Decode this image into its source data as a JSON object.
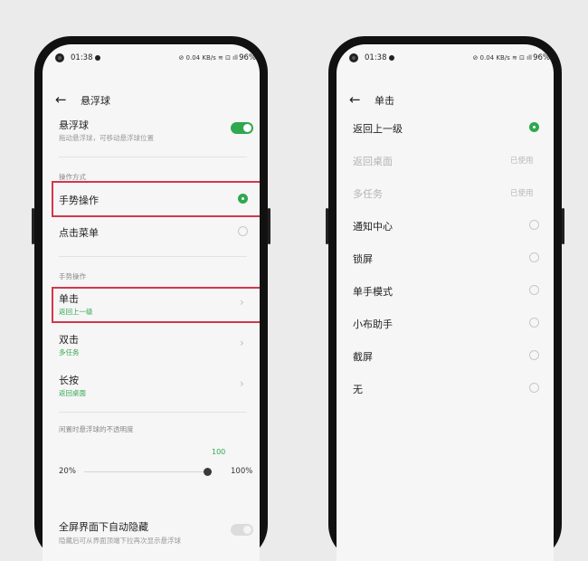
{
  "status": {
    "time": "01:38",
    "icons": "⊘ 0.04 KB/s ≋ ⊡ ıll",
    "battery": "96%"
  },
  "floating_ball": {
    "title": "悬浮球",
    "toggle_label": "悬浮球",
    "toggle_desc": "拖动悬浮球，可移动悬浮球位置",
    "toggle_on": true,
    "section_op_mode": "操作方式",
    "gesture_label": "手势操作",
    "menu_label": "点击菜单",
    "section_gestures": "手势操作",
    "gestures": [
      {
        "label": "单击",
        "value": "返回上一级"
      },
      {
        "label": "双击",
        "value": "多任务"
      },
      {
        "label": "长按",
        "value": "返回桌面"
      }
    ],
    "opacity_label": "闲置时悬浮球的不透明度",
    "opacity_value": "100",
    "opacity_min": "20%",
    "opacity_max": "100%",
    "opacity_level": 1.0,
    "fullscreen_label": "全屏界面下自动隐藏",
    "fullscreen_desc": "隐藏后可从界面顶端下拉再次显示悬浮球",
    "fullscreen_on": false
  },
  "single_tap": {
    "title": "单击",
    "used_label": "已使用",
    "options": [
      {
        "label": "返回上一级",
        "selected": true
      },
      {
        "label": "返回桌面",
        "disabled": true
      },
      {
        "label": "多任务",
        "disabled": true
      },
      {
        "label": "通知中心"
      },
      {
        "label": "锁屏"
      },
      {
        "label": "单手模式"
      },
      {
        "label": "小布助手"
      },
      {
        "label": "截屏"
      },
      {
        "label": "无"
      }
    ]
  },
  "colors": {
    "accent": "#2fa84f",
    "highlight": "#d2374c"
  }
}
